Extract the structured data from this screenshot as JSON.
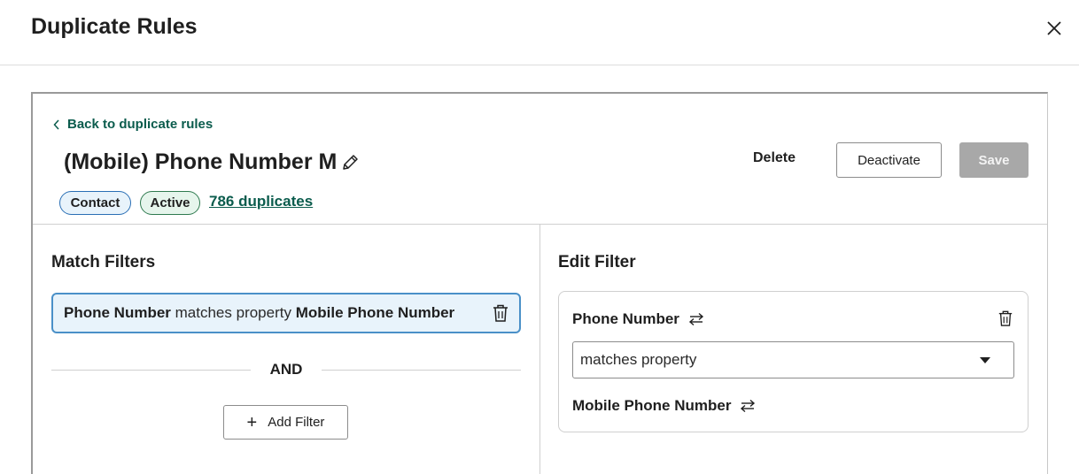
{
  "modal": {
    "title": "Duplicate Rules",
    "close_icon": "close-icon"
  },
  "header": {
    "back_label": "Back to duplicate rules",
    "rule_name": "(Mobile) Phone Number M",
    "tags": [
      "Contact",
      "Active"
    ],
    "duplicates_link": "786 duplicates",
    "delete_label": "Delete",
    "deactivate_label": "Deactivate",
    "save_label": "Save"
  },
  "match_filters": {
    "title": "Match Filters",
    "filters": [
      {
        "property": "Phone Number",
        "operator": "matches property",
        "target": "Mobile Phone Number"
      }
    ],
    "join_label": "AND",
    "add_label": "Add Filter"
  },
  "edit_filter": {
    "title": "Edit Filter",
    "property": "Phone Number",
    "operator": "matches property",
    "target": "Mobile Phone Number"
  },
  "colors": {
    "link": "#0b5c4d",
    "chip_bg": "#e8f3fb",
    "chip_border": "#4a90c8",
    "save_disabled": "#a8a8a8"
  }
}
